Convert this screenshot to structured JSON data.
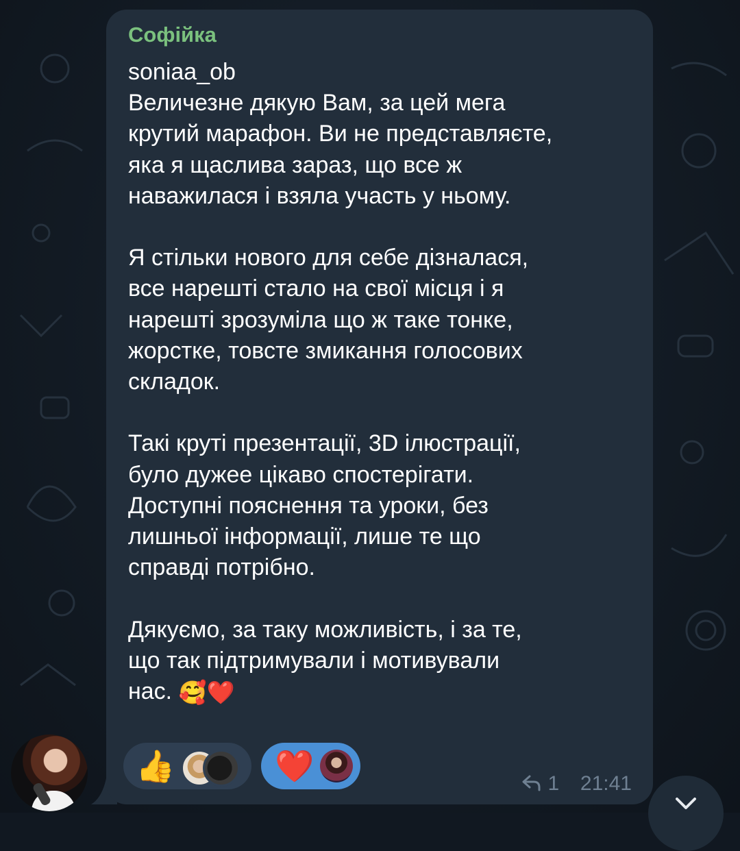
{
  "message": {
    "sender_name": "Софійка",
    "lines": [
      "soniaa_ob",
      "Величезне дякую Вам, за цей мега",
      "крутий марафон. Ви не представляєте,",
      "яка я щаслива зараз, що все ж",
      "наважилася і взяла участь у ньому.",
      "",
      "Я стільки нового для себе дізналася,",
      "все нарешті стало на свої місця і я",
      "нарешті зрозуміла що ж таке тонке,",
      "жорстке, товсте змикання голосових",
      "складок.",
      "",
      "Такі круті презентації, 3D ілюстрації,",
      "було дужее цікаво спостерігати.",
      "Доступні пояснення та уроки, без",
      "лишньої інформації, лише те що",
      "справді потрібно.",
      "",
      "Дякуємо, за таку можливість, і за те,",
      "що так підтримували і мотивували",
      "нас."
    ],
    "closing_emojis": "🥰❤️",
    "reply_count": "1",
    "time": "21:41"
  },
  "reactions": [
    {
      "emoji": "👍",
      "icon": "thumbs-up-icon",
      "reactor_avatars": 2
    },
    {
      "emoji": "❤️",
      "icon": "heart-icon",
      "reactor_avatars": 1,
      "selected": true
    }
  ],
  "colors": {
    "sender": "#7bc17e",
    "bubble": "#222e3b",
    "selected_reaction": "#4a90d6",
    "meta": "#6f8092"
  }
}
